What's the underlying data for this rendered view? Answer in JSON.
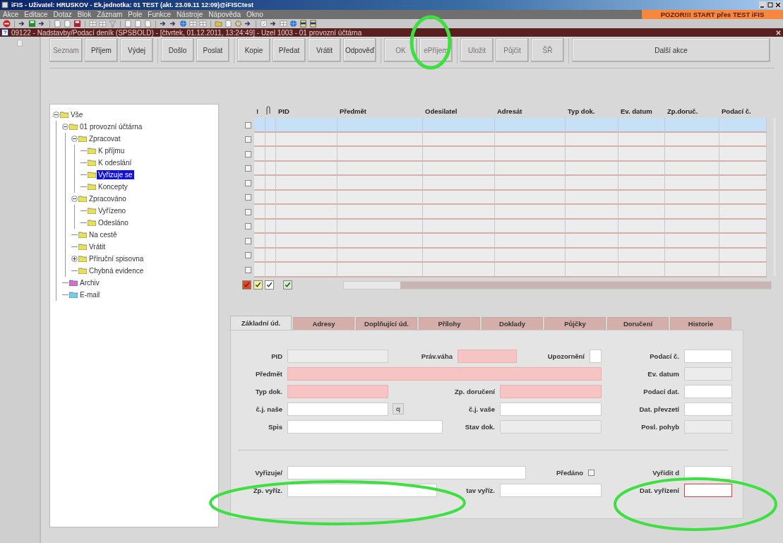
{
  "window": {
    "title": "iFIS - Uživatel: HRUSKOV - Ek.jednotka: 01 TEST (akt. 23.09.11 12:09)@iFISCtest"
  },
  "menu": [
    "Akce",
    "Editace",
    "Dotaz",
    "Blok",
    "Záznam",
    "Pole",
    "Funkce",
    "Nástroje",
    "Nápověda",
    "Okno"
  ],
  "warning_banner": "POZOR!!! START přes TEST iFIS",
  "form_window": {
    "title": "09122 - Nadstavby/Podací deník (SPSBOLD) - [čtvrtek, 01.12.2011, 13:24:49] - Uzel 1003 - 01 provozní účtárna"
  },
  "button_groups": [
    [
      {
        "label": "Seznam",
        "disabled": true
      },
      {
        "label": "Příjem",
        "disabled": false
      },
      {
        "label": "Výdej",
        "disabled": false
      }
    ],
    [
      {
        "label": "Došlo",
        "disabled": false
      },
      {
        "label": "Poslat",
        "disabled": false
      }
    ],
    [
      {
        "label": "Kopie",
        "disabled": false
      },
      {
        "label": "Předat",
        "disabled": false
      },
      {
        "label": "Vrátit",
        "disabled": false
      },
      {
        "label": "Odpověď",
        "disabled": false
      }
    ],
    [
      {
        "label": "OK",
        "disabled": true
      },
      {
        "label": "ePříjem",
        "disabled": true
      }
    ],
    [
      {
        "label": "Uložit",
        "disabled": true
      },
      {
        "label": "Půjčit",
        "disabled": true
      },
      {
        "label": "ŠŘ",
        "disabled": true
      }
    ],
    [
      {
        "label": "Další akce",
        "disabled": false
      }
    ]
  ],
  "tree": {
    "label": "Vše",
    "kind": "expanded",
    "color": "#e6e05a",
    "selected": false,
    "children": [
      {
        "label": "01 provozní účtárna",
        "kind": "expanded",
        "color": "#e6e05a",
        "selected": false,
        "children": [
          {
            "label": "Zpracovat",
            "kind": "expanded",
            "color": "#e6e05a",
            "selected": false,
            "children": [
              {
                "label": "K příjmu",
                "kind": "leaf",
                "color": "#e6e05a",
                "selected": false
              },
              {
                "label": "K odeslání",
                "kind": "leaf",
                "color": "#e6e05a",
                "selected": false
              },
              {
                "label": "Vyřizuje se",
                "kind": "leaf",
                "color": "#e6e05a",
                "selected": true
              },
              {
                "label": "Koncepty",
                "kind": "leaf",
                "color": "#e6e05a",
                "selected": false
              }
            ]
          },
          {
            "label": "Zpracováno",
            "kind": "expanded",
            "color": "#e6e05a",
            "selected": false,
            "children": [
              {
                "label": "Vyřízeno",
                "kind": "leaf",
                "color": "#e6e05a",
                "selected": false
              },
              {
                "label": "Odesláno",
                "kind": "leaf",
                "color": "#e6e05a",
                "selected": false
              }
            ]
          },
          {
            "label": "Na cestě",
            "kind": "leaf",
            "color": "#e6e05a",
            "selected": false
          },
          {
            "label": "Vrátit",
            "kind": "leaf",
            "color": "#e6e05a",
            "selected": false
          },
          {
            "label": "Příruční spisovna",
            "kind": "collapsed",
            "color": "#e6e05a",
            "selected": false
          },
          {
            "label": "Chybná evidence",
            "kind": "leaf",
            "color": "#e6e05a",
            "selected": false
          }
        ]
      },
      {
        "label": "Archiv",
        "kind": "leaf",
        "color": "#d070c8",
        "selected": false
      },
      {
        "label": "E-mail",
        "kind": "leaf",
        "color": "#70d0e8",
        "selected": false
      }
    ]
  },
  "table": {
    "columns": [
      "!",
      "PID",
      "Předmět",
      "Odesilatel",
      "Adresát",
      "Typ dok.",
      "Ev. datum",
      "Zp.doruč.",
      "Podací č."
    ],
    "rows": [
      {
        "selected": true,
        "checked": false
      },
      {
        "selected": false,
        "checked": false
      },
      {
        "selected": false,
        "checked": false
      },
      {
        "selected": false,
        "checked": false
      },
      {
        "selected": false,
        "checked": false
      },
      {
        "selected": false,
        "checked": false
      },
      {
        "selected": false,
        "checked": false
      },
      {
        "selected": false,
        "checked": false
      },
      {
        "selected": false,
        "checked": false
      },
      {
        "selected": false,
        "checked": false
      },
      {
        "selected": false,
        "checked": false
      }
    ]
  },
  "legend": [
    {
      "color": "#e8461e"
    },
    {
      "color": "#f4f0a0"
    },
    {
      "color": "#ffffff"
    },
    {
      "color": "#d4efcc"
    }
  ],
  "tabs": [
    {
      "label": "Základní úd.",
      "selected": true
    },
    {
      "label": "Adresy",
      "selected": false
    },
    {
      "label": "Doplňující úd.",
      "selected": false
    },
    {
      "label": "Přílohy",
      "selected": false
    },
    {
      "label": "Doklady",
      "selected": false
    },
    {
      "label": "Půjčky",
      "selected": false
    },
    {
      "label": "Doručení",
      "selected": false
    },
    {
      "label": "Historie",
      "selected": false
    }
  ],
  "form": {
    "fields": [
      {
        "label": "PID",
        "kind": "disabled"
      },
      {
        "label": "Práv.váha",
        "kind": "required"
      },
      {
        "label": "Upozornění",
        "kind": "normal"
      },
      {
        "label": "Podací č.",
        "kind": "normal"
      },
      {
        "label": "Předmět",
        "kind": "required"
      },
      {
        "label": "Ev. datum",
        "kind": "disabled"
      },
      {
        "label": "Typ dok.",
        "kind": "required"
      },
      {
        "label": "Zp. doručení",
        "kind": "required"
      },
      {
        "label": "Podací dat.",
        "kind": "normal"
      },
      {
        "label": "č.j. naše",
        "kind": "normal"
      },
      {
        "label": "č.j. vaše",
        "kind": "normal"
      },
      {
        "label": "Dat. převzetí",
        "kind": "normal"
      },
      {
        "label": "Spis",
        "kind": "normal"
      },
      {
        "label": "Stav dok.",
        "kind": "disabled"
      },
      {
        "label": "Posl. pohyb",
        "kind": "disabled"
      },
      {
        "label": "Vyřizuje/",
        "kind": "normal"
      },
      {
        "label": "Vyřídit d",
        "kind": "normal"
      },
      {
        "label": "Zp. vyříz.",
        "kind": "normal"
      },
      {
        "label": "tav vyříz.",
        "kind": "normal"
      },
      {
        "label": "Dat. vyřízení",
        "kind": "error"
      }
    ],
    "cj_button": "čj",
    "handed_over": {
      "label": "Předáno",
      "checked": false
    }
  }
}
